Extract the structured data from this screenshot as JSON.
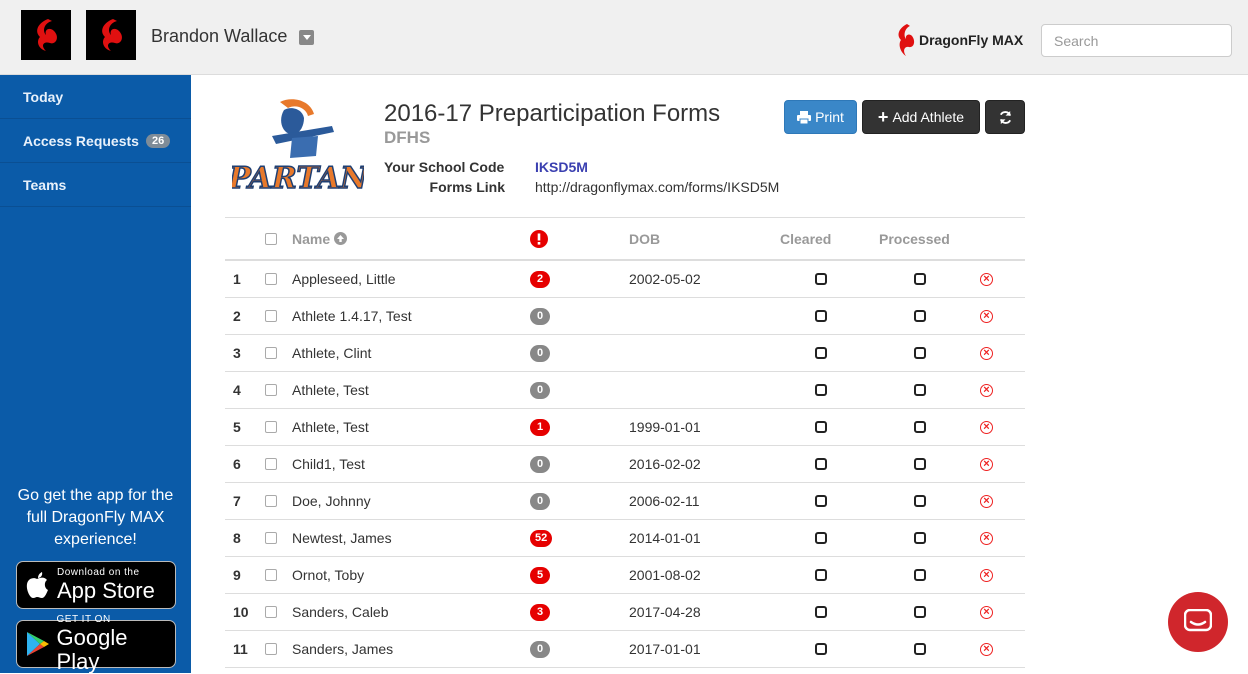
{
  "header": {
    "user_name": "Brandon Wallace",
    "brand_name": "DragonFly MAX",
    "search_placeholder": "Search"
  },
  "sidebar": {
    "items": [
      {
        "label": "Today",
        "badge": ""
      },
      {
        "label": "Access Requests",
        "badge": "26"
      },
      {
        "label": "Teams",
        "badge": ""
      }
    ],
    "promo_text": "Go get the app for the full DragonFly MAX experience!",
    "app_store": {
      "small": "Download on the",
      "big": "App Store"
    },
    "google_play": {
      "small": "GET IT ON",
      "big": "Google Play"
    }
  },
  "page": {
    "title": "2016-17 Preparticipation Forms",
    "subtitle": "DFHS",
    "school_code_label": "Your School Code",
    "school_code": "IKSD5M",
    "forms_link_label": "Forms Link",
    "forms_link": "http://dragonflymax.com/forms/IKSD5M",
    "print_label": "Print",
    "add_label": "Add Athlete",
    "logo_text": "SPARTANS"
  },
  "table": {
    "headers": {
      "name": "Name",
      "dob": "DOB",
      "cleared": "Cleared",
      "processed": "Processed"
    },
    "rows": [
      {
        "num": "1",
        "name": "Appleseed, Little",
        "flags": "2",
        "flag_color": "red",
        "dob": "2002-05-02"
      },
      {
        "num": "2",
        "name": "Athlete 1.4.17, Test",
        "flags": "0",
        "flag_color": "gray",
        "dob": ""
      },
      {
        "num": "3",
        "name": "Athlete, Clint",
        "flags": "0",
        "flag_color": "gray",
        "dob": ""
      },
      {
        "num": "4",
        "name": "Athlete, Test",
        "flags": "0",
        "flag_color": "gray",
        "dob": ""
      },
      {
        "num": "5",
        "name": "Athlete, Test",
        "flags": "1",
        "flag_color": "red",
        "dob": "1999-01-01"
      },
      {
        "num": "6",
        "name": "Child1, Test",
        "flags": "0",
        "flag_color": "gray",
        "dob": "2016-02-02"
      },
      {
        "num": "7",
        "name": "Doe, Johnny",
        "flags": "0",
        "flag_color": "gray",
        "dob": "2006-02-11"
      },
      {
        "num": "8",
        "name": "Newtest, James",
        "flags": "52",
        "flag_color": "red",
        "dob": "2014-01-01"
      },
      {
        "num": "9",
        "name": "Ornot, Toby",
        "flags": "5",
        "flag_color": "red",
        "dob": "2001-08-02"
      },
      {
        "num": "10",
        "name": "Sanders, Caleb",
        "flags": "3",
        "flag_color": "red",
        "dob": "2017-04-28"
      },
      {
        "num": "11",
        "name": "Sanders, James",
        "flags": "0",
        "flag_color": "gray",
        "dob": "2017-01-01"
      }
    ]
  },
  "colors": {
    "sidebar": "#0b5ba8",
    "accent_red": "#e60000",
    "print_blue": "#3a87c8"
  }
}
